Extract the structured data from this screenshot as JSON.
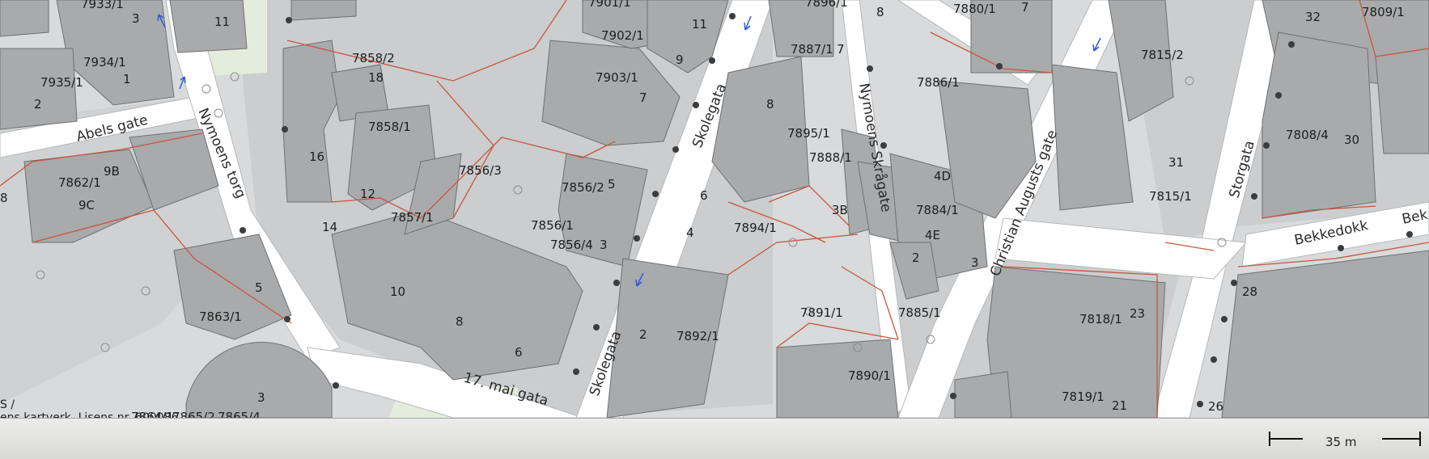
{
  "map": {
    "labels": {
      "b7933_1": "7933/1",
      "n3a": "3",
      "n11a": "11",
      "b7934_1": "7934/1",
      "n1a": "1",
      "b7935_1": "7935/1",
      "n2a": "2",
      "b7862_1": "7862/1",
      "n9B": "9B",
      "n9C": "9C",
      "b_8": "8",
      "b7858_2": "7858/2",
      "n18": "18",
      "b7858_1": "7858/1",
      "n16": "16",
      "n12": "12",
      "n14": "14",
      "b7857_1": "7857/1",
      "b7856_3": "7856/3",
      "b7856_2": "7856/2",
      "n5a": "5",
      "b7856_1": "7856/1",
      "b7856_4": "7856/4",
      "n3b": "3",
      "n10": "10",
      "n8a": "8",
      "n6a": "6",
      "b7901_1": "7901/1",
      "b7902_1": "7902/1",
      "n11b": "11",
      "n9a": "9",
      "b7903_1": "7903/1",
      "n7a": "7",
      "b7863_1": "7863/1",
      "n5b": "5",
      "n3c": "3",
      "b7864_1": "7864/1",
      "b7865_2": "7865/2",
      "b7865_4": "7865/4",
      "b7896_1": "7896/1",
      "n8b": "8",
      "b7887_1": "7887/1",
      "n7b": "7",
      "n8c": "8",
      "b7895_1": "7895/1",
      "b7888_1": "7888/1",
      "n6b": "6",
      "n4a": "4",
      "b7894_1": "7894/1",
      "n3B": "3B",
      "n2b": "2",
      "b7892_1": "7892/1",
      "b7891_1": "7891/1",
      "b7890_1": "7890/1",
      "b7880_1": "7880/1",
      "n7c": "7",
      "b7886_1": "7886/1",
      "n4D": "4D",
      "b7884_1": "7884/1",
      "n4E": "4E",
      "n2c": "2",
      "n3d": "3",
      "b7885_1": "7885/1",
      "b7815_2": "7815/2",
      "n31": "31",
      "b7815_1": "7815/1",
      "n32": "32",
      "b7809_1": "7809/1",
      "b7808_4": "7808/4",
      "n30": "30",
      "n28": "28",
      "b7818_1": "7818/1",
      "n23": "23",
      "b7819_1": "7819/1",
      "n21": "21",
      "n26": "26"
    },
    "streets": {
      "abels_gate": "Abels gate",
      "nymoens_torg": "Nymoens torg",
      "skolegata_north": "Skolegata",
      "skolegata_south": "Skolegata",
      "nymoens_skragate": "Nymoens Skrågate",
      "christian_augusts_gate": "Christian Augusts gate",
      "storgata": "Storgata",
      "bekkedokk": "Bekkedokk",
      "bekkedokk_cut": "Bek",
      "mai_gata": "17. mai gata"
    },
    "attribution": {
      "line1": "S /",
      "line2": "ens kartverk. Lisens nr. 600086"
    },
    "colors": {
      "background": "#d8dadb",
      "road": "#ffffff",
      "building": "#a8a9ab",
      "building_edge": "#6f7072",
      "block": "#c9cbcc",
      "property_line": "#c8573c",
      "oneway_arrow": "#2f5bd8",
      "green": "#e3ebdc"
    }
  },
  "statusbar": {
    "scale_label": "35 m"
  }
}
